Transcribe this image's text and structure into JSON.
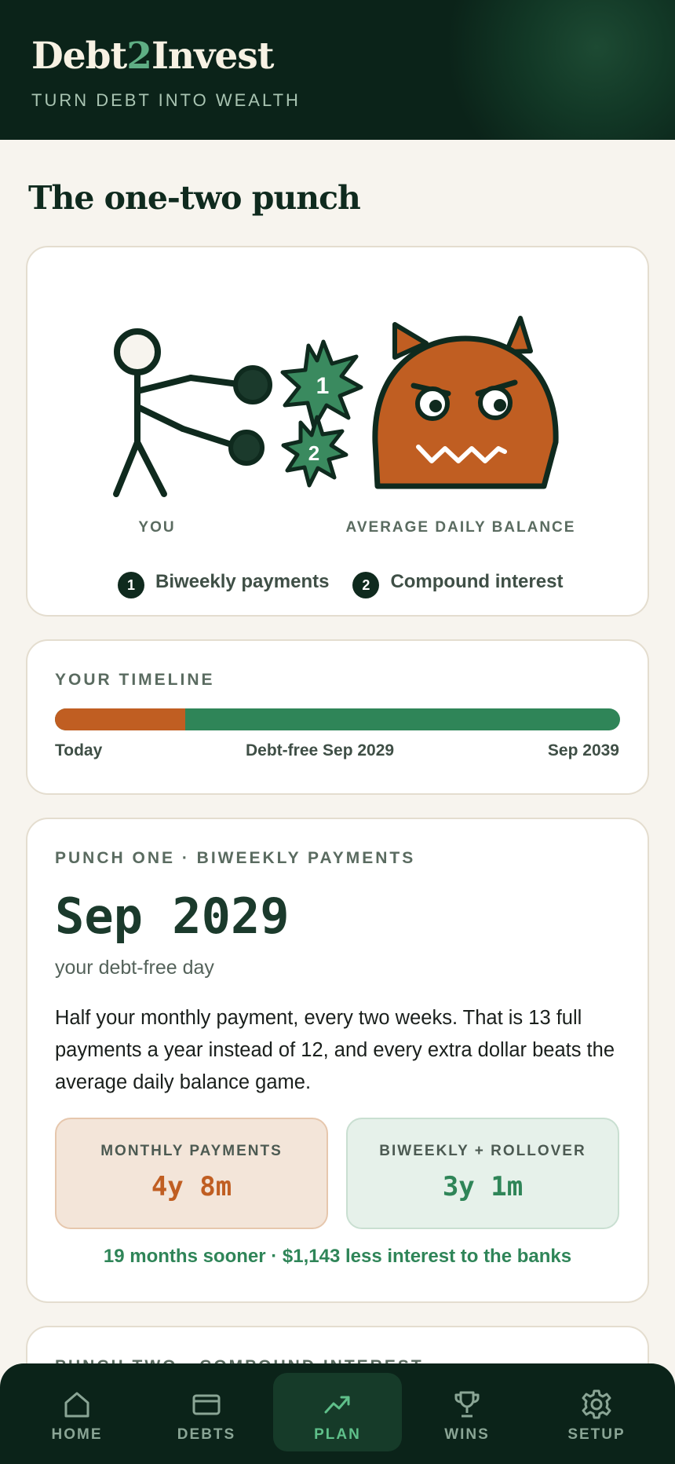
{
  "app": {
    "name_part1": "Debt",
    "name_part2": "2",
    "name_part3": "Invest",
    "tagline": "TURN DEBT INTO WEALTH"
  },
  "page": {
    "title": "The one-two punch"
  },
  "illustration": {
    "you_label": "YOU",
    "enemy_label": "AVERAGE DAILY BALANCE",
    "burst1": "1",
    "burst2": "2",
    "legend": [
      {
        "num": "1",
        "label": "Biweekly payments"
      },
      {
        "num": "2",
        "label": "Compound interest"
      }
    ],
    "colors": {
      "dark": "#0f2a1e",
      "green": "#3a8a5f",
      "monster": "#c05e22"
    }
  },
  "timeline": {
    "label": "YOUR TIMELINE",
    "debt_fraction": 0.23,
    "start_label": "Today",
    "mid_label": "Debt-free Sep 2029",
    "end_label": "Sep 2039",
    "colors": {
      "debt": "#c05e22",
      "invest": "#2f8558"
    }
  },
  "punch_one": {
    "label": "PUNCH ONE · BIWEEKLY PAYMENTS",
    "date": "Sep 2029",
    "subtitle": "your debt-free day",
    "description": "Half your monthly payment, every two weeks. That is 13 full payments a year instead of 12, and every extra dollar beats the average daily balance game.",
    "monthly_label": "MONTHLY PAYMENTS",
    "monthly_value": "4y 8m",
    "biweekly_label": "BIWEEKLY + ROLLOVER",
    "biweekly_value": "3y 1m",
    "savings": "19 months sooner · $1,143 less interest to the banks"
  },
  "punch_two": {
    "label": "PUNCH TWO · COMPOUND INTEREST"
  },
  "nav": {
    "items": [
      {
        "label": "HOME",
        "icon": "home-icon"
      },
      {
        "label": "DEBTS",
        "icon": "card-icon"
      },
      {
        "label": "PLAN",
        "icon": "trend-icon",
        "active": true
      },
      {
        "label": "WINS",
        "icon": "trophy-icon"
      },
      {
        "label": "SETUP",
        "icon": "gear-icon"
      }
    ]
  }
}
